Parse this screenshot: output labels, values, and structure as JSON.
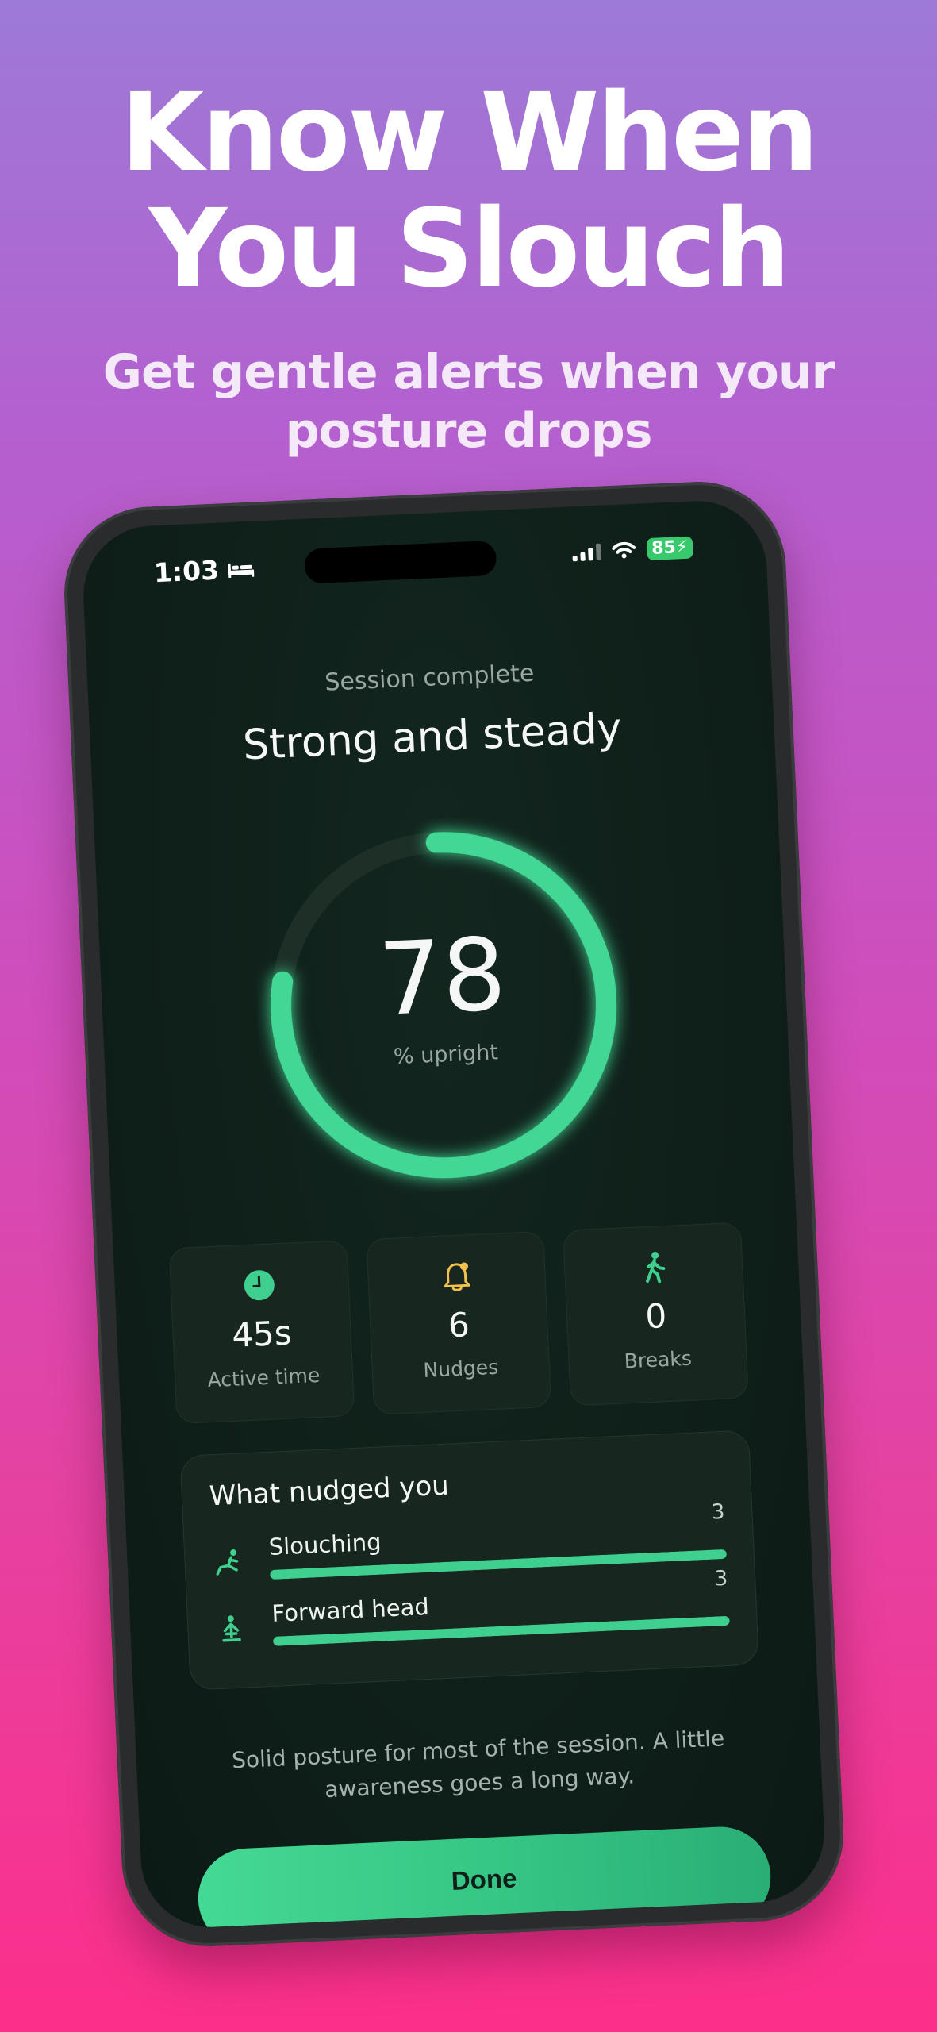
{
  "promo": {
    "headline_line1": "Know When",
    "headline_line2": "You Slouch",
    "subhead_line1": "Get gentle alerts when your",
    "subhead_line2": "posture drops"
  },
  "status_bar": {
    "time": "1:03",
    "battery": "85"
  },
  "session": {
    "label": "Session complete",
    "title": "Strong and steady",
    "score": "78",
    "score_caption": "% upright",
    "upright_fraction": 0.78
  },
  "stats": [
    {
      "icon": "clock-icon",
      "value": "45s",
      "label": "Active time"
    },
    {
      "icon": "bell-icon",
      "value": "6",
      "label": "Nudges"
    },
    {
      "icon": "walking-icon",
      "value": "0",
      "label": "Breaks"
    }
  ],
  "nudges": {
    "title": "What nudged you",
    "items": [
      {
        "icon": "slouch-icon",
        "label": "Slouching",
        "count": "3",
        "fraction": 1.0
      },
      {
        "icon": "forward-head-icon",
        "label": "Forward head",
        "count": "3",
        "fraction": 1.0
      }
    ]
  },
  "summary": "Solid posture for most of the session. A little awareness goes a long way.",
  "done_label": "Done",
  "colors": {
    "accent": "#3fcf8e",
    "bell": "#f2c14e",
    "background_top": "#9d7ad6",
    "background_bottom": "#fc2f8a"
  }
}
